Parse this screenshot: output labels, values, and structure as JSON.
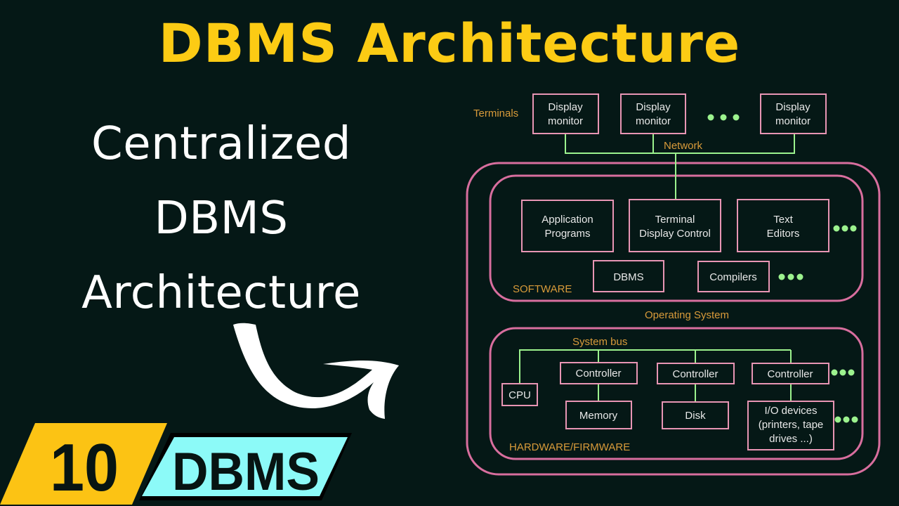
{
  "page": {
    "title": "DBMS Architecture",
    "subtitle_lines": [
      "Centralized",
      "DBMS",
      "Architecture"
    ],
    "badge_number": "10",
    "badge_label": "DBMS",
    "colors": {
      "background": "#051816",
      "title": "#fccb14",
      "badge_number_bg": "#fcc314",
      "badge_label_bg": "#8cfaf8",
      "box_border": "#e895b4",
      "container_border": "#d86e9e",
      "connector": "#9cf28e",
      "label_orange": "#d99b3a",
      "box_text": "#e8e8e8"
    }
  },
  "diagram": {
    "terminals_label": "Terminals",
    "network_label": "Network",
    "terminals": [
      {
        "line1": "Display",
        "line2": "monitor"
      },
      {
        "line1": "Display",
        "line2": "monitor"
      },
      {
        "line1": "Display",
        "line2": "monitor"
      }
    ],
    "software": {
      "label": "SOFTWARE",
      "boxes_row1": [
        {
          "line1": "Application",
          "line2": "Programs"
        },
        {
          "line1": "Terminal",
          "line2": "Display Control"
        },
        {
          "line1": "Text",
          "line2": "Editors"
        }
      ],
      "boxes_row2": [
        "DBMS",
        "Compilers"
      ]
    },
    "os_label": "Operating System",
    "hardware": {
      "label": "HARDWARE/FIRMWARE",
      "bus_label": "System bus",
      "cpu": "CPU",
      "controllers": [
        "Controller",
        "Controller",
        "Controller"
      ],
      "devices": [
        {
          "lines": [
            "Memory"
          ]
        },
        {
          "lines": [
            "Disk"
          ]
        },
        {
          "lines": [
            "I/O devices",
            "(printers, tape",
            "drives ...)"
          ]
        }
      ]
    },
    "ellipsis_icon": "three-dots-icon"
  }
}
